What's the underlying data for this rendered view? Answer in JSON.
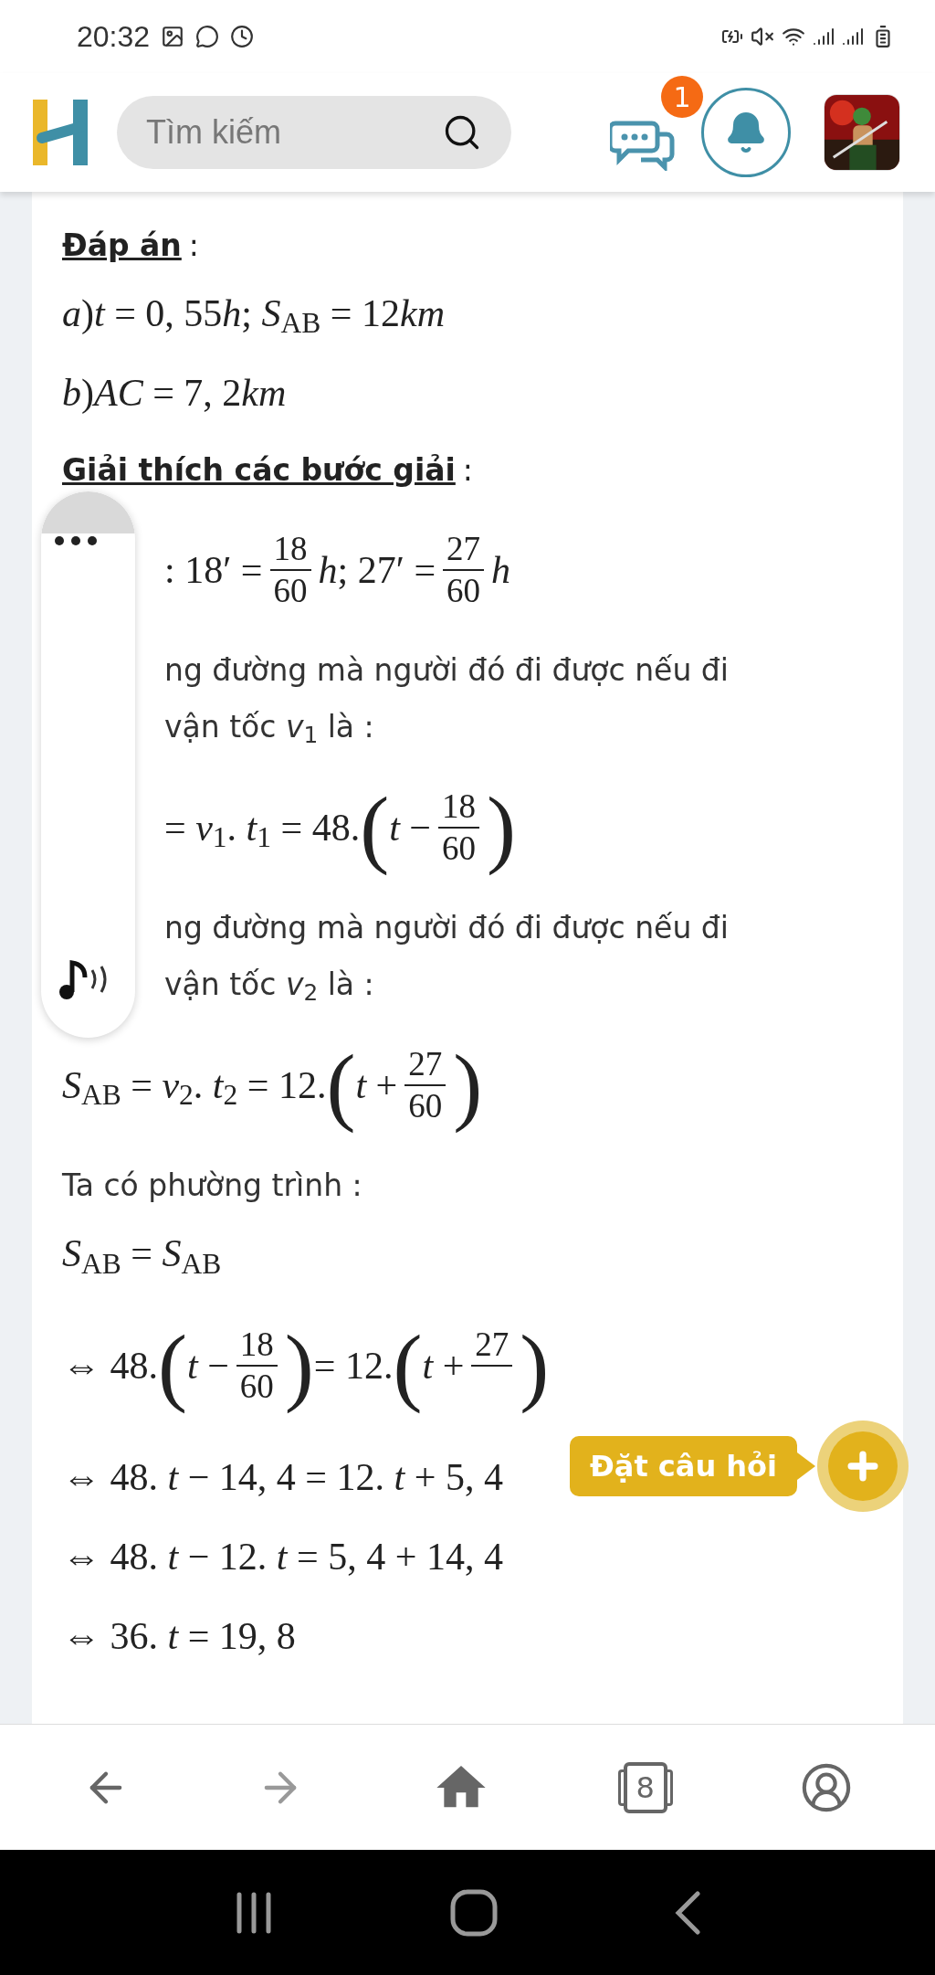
{
  "status_bar": {
    "time": "20:32"
  },
  "header": {
    "search": {
      "placeholder": "Tìm kiếm"
    },
    "messages_badge": "1"
  },
  "content": [
    {
      "kind": "heading",
      "text": "Đáp án",
      "suffix": ":"
    },
    {
      "kind": "math",
      "items": [
        {
          "kind": "text",
          "s": "*a*)*t* = 0, 55"
        },
        {
          "kind": "text",
          "s": "*h*; *S*$_{AB}$ = 12"
        },
        {
          "kind": "text",
          "s": "*km*"
        }
      ]
    },
    {
      "kind": "math",
      "items": [
        {
          "kind": "text",
          "s": "*b*)*AC* = 7, 2"
        },
        {
          "kind": "text",
          "s": "*km*"
        }
      ]
    },
    {
      "kind": "heading",
      "text": "Giải thích các bước giải",
      "suffix": ":"
    },
    {
      "kind": "math",
      "clipped": true,
      "items": [
        {
          "kind": "text",
          "s": ": 18′ ="
        },
        {
          "kind": "frac",
          "num": "18",
          "den": "60"
        },
        {
          "kind": "text",
          "s": "*h*; 27′ ="
        },
        {
          "kind": "frac",
          "num": "27",
          "den": "60"
        },
        {
          "kind": "text",
          "s": "*h*"
        }
      ]
    },
    {
      "kind": "text",
      "clipped": true,
      "s": "ng đường mà người đó đi được nếu đi"
    },
    {
      "kind": "text",
      "clipped": true,
      "s": "vận tốc *v*$_{1}$ là :"
    },
    {
      "kind": "math",
      "clipped": true,
      "items": [
        {
          "kind": "text",
          "s": "= *v*$_{1}$. *t*$_{1}$ = 48."
        },
        {
          "kind": "group",
          "open": "(",
          "close": ")",
          "items": [
            {
              "kind": "text",
              "s": "*t* −"
            },
            {
              "kind": "frac",
              "num": "18",
              "den": "60"
            }
          ]
        }
      ]
    },
    {
      "kind": "text",
      "clipped": true,
      "s": "ng đường mà người đó đi được nếu đi"
    },
    {
      "kind": "text",
      "clipped": true,
      "s": "vận tốc *v*$_{2}$ là :"
    },
    {
      "kind": "math",
      "items": [
        {
          "kind": "text",
          "s": "*S*$_{AB}$ = *v*$_{2}$. *t*$_{2}$ = 12."
        },
        {
          "kind": "group",
          "open": "(",
          "close": ")",
          "items": [
            {
              "kind": "text",
              "s": "*t* +"
            },
            {
              "kind": "frac",
              "num": "27",
              "den": "60"
            }
          ]
        }
      ]
    },
    {
      "kind": "text",
      "s": "Ta có phường trình :"
    },
    {
      "kind": "math",
      "items": [
        {
          "kind": "text",
          "s": "*S*$_{AB}$ = *S*$_{AB}$"
        }
      ]
    },
    {
      "kind": "math",
      "items": [
        {
          "kind": "text",
          "s": "⇔ 48."
        },
        {
          "kind": "group",
          "open": "(",
          "close": ")",
          "items": [
            {
              "kind": "text",
              "s": "*t* −"
            },
            {
              "kind": "frac",
              "num": "18",
              "den": "60"
            }
          ]
        },
        {
          "kind": "text",
          "s": "= 12."
        },
        {
          "kind": "group",
          "open": "(",
          "close": ")",
          "items": [
            {
              "kind": "text",
              "s": "*t* +"
            },
            {
              "kind": "frac",
              "num": "27"
            }
          ]
        }
      ]
    },
    {
      "kind": "math",
      "items": [
        {
          "kind": "text",
          "s": "⇔ 48. *t* − 14, 4 = 12. *t* + 5, 4"
        }
      ]
    },
    {
      "kind": "math",
      "items": [
        {
          "kind": "text",
          "s": "⇔ 48. *t* − 12. *t* = 5, 4 + 14, 4"
        }
      ]
    },
    {
      "kind": "math",
      "items": [
        {
          "kind": "text",
          "s": "⇔ 36. *t* = 19, 8"
        }
      ]
    }
  ],
  "ask_button": {
    "label": "Đặt câu hỏi"
  },
  "bottom_nav": {
    "tab_count": "8"
  }
}
